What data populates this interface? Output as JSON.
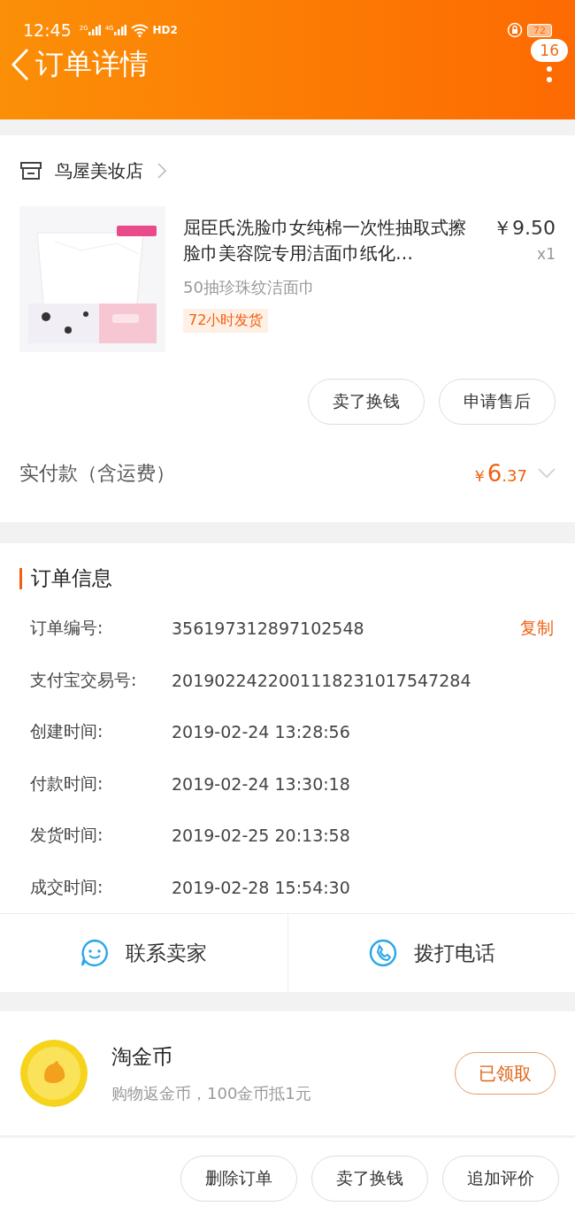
{
  "status_bar": {
    "time": "12:45",
    "signals": [
      {
        "label": "2G"
      },
      {
        "label": "4G"
      }
    ],
    "network": "HD2",
    "battery": "72"
  },
  "header": {
    "title": "订单详情",
    "badge": "16"
  },
  "shop": {
    "name": "鸟屋美妆店"
  },
  "product": {
    "kind": "picture",
    "title": "屈臣氏洗脸巾女纯棉一次性抽取式擦脸巾美容院专用洁面巾纸化…",
    "price": "￥9.50",
    "quantity": "x1",
    "variant": "50抽珍珠纹洁面巾",
    "tag": "72小时发货"
  },
  "item_actions": [
    "卖了换钱",
    "申请售后"
  ],
  "payment": {
    "label": "实付款（含运费）",
    "currency": "￥",
    "integer": "6",
    "decimal": ".37"
  },
  "order_info": {
    "title": "订单信息",
    "copy_label": "复制",
    "rows": [
      {
        "label": "订单编号:",
        "value": "356197312897102548"
      },
      {
        "label": "支付宝交易号:",
        "value": "2019022422001118231017547284"
      },
      {
        "label": "创建时间:",
        "value": "2019-02-24 13:28:56"
      },
      {
        "label": "付款时间:",
        "value": "2019-02-24 13:30:18"
      },
      {
        "label": "发货时间:",
        "value": "2019-02-25 20:13:58"
      },
      {
        "label": "成交时间:",
        "value": "2019-02-28 15:54:30"
      }
    ]
  },
  "contact": [
    {
      "kind": "chat",
      "label": "联系卖家"
    },
    {
      "kind": "phone",
      "label": "拨打电话"
    }
  ],
  "coins": {
    "title": "淘金币",
    "subtitle": "购物返金币，100金币抵1元",
    "button": "已领取"
  },
  "bottom_actions": [
    "删除订单",
    "卖了换钱",
    "追加评价"
  ]
}
